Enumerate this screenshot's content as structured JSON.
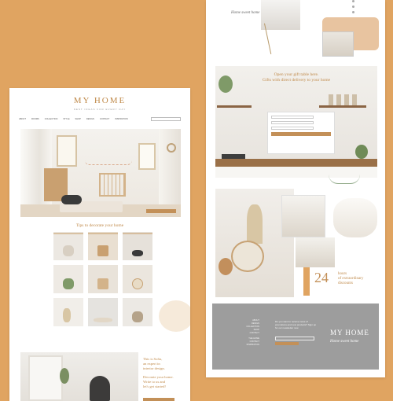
{
  "left_page": {
    "logo": "MY HOME",
    "tagline": "NEST IDEAS FOR EVERY DAY",
    "nav": [
      "ABOUT",
      "ROOMS",
      "COLLECTION",
      "STYLE",
      "SHOP",
      "DESIGN",
      "CONTACT",
      "INSPIRATION"
    ],
    "announcement": "",
    "tips_title": "Tips to decorate your home",
    "about_lines": [
      "This is Sofia,",
      "an expert in",
      "interior design.",
      "Decorate your home.",
      "Write to us and",
      "let's get started!"
    ]
  },
  "right_page": {
    "quote": "",
    "signature": "Home sweet home",
    "gift_heading_1": "Open your gift table here.",
    "gift_heading_2": "Gifts with direct delivery to your home",
    "promo_number": "24",
    "promo_unit": "hours",
    "promo_line_2": "of extraordinary",
    "promo_line_3": "discounts",
    "footer": {
      "links": [
        "ABOUT",
        "DESIGN",
        "COLLECTION",
        "SHOP",
        "CONTACT",
        "THE HOME",
        "CONTACT",
        "INSPIRATION"
      ],
      "subscribe_text": "Do you want to receive news of promotions and new products? Sign up for our newsletter now",
      "small_label": "",
      "logo": "MY HOME",
      "signature": "Home sweet home"
    }
  },
  "colors": {
    "background": "#e0a461",
    "accent": "#c39058",
    "title": "#c08a4a",
    "footer": "#9d9d9d"
  }
}
